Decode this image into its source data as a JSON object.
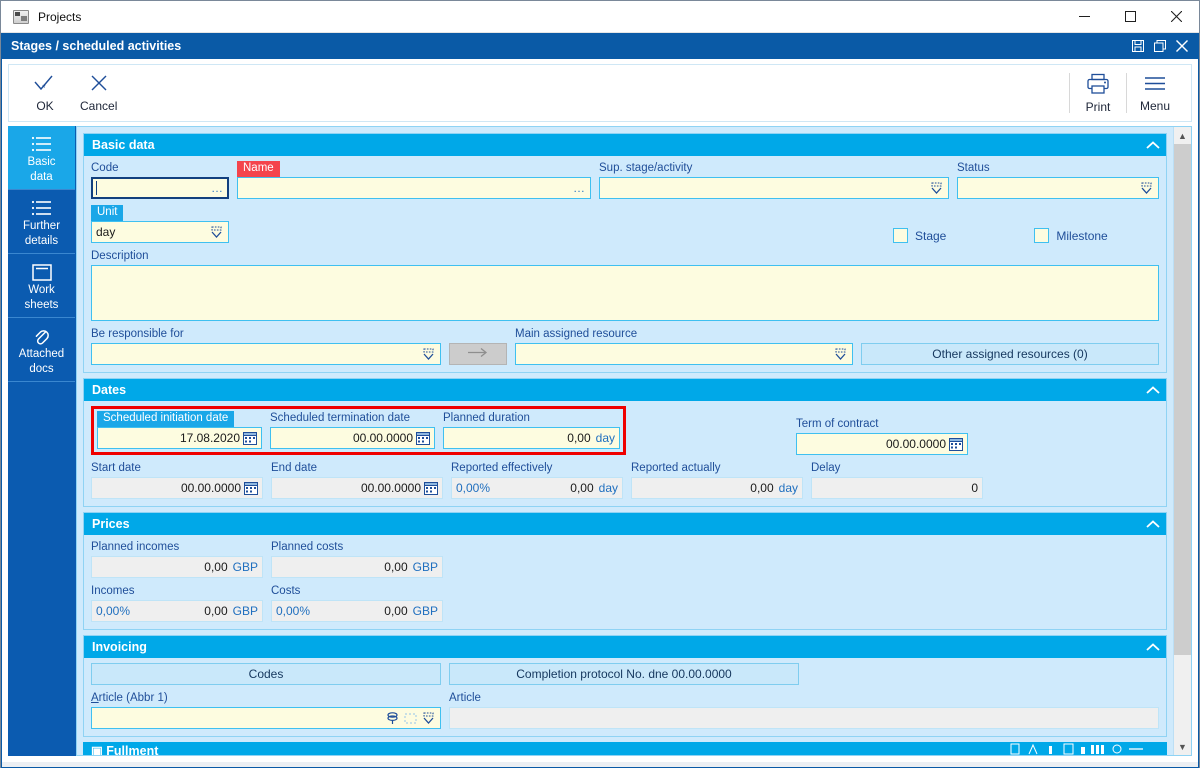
{
  "os": {
    "title": "Projects",
    "app_icon": "application-icon",
    "minimize": "—",
    "maximize": "☐",
    "close": "✕"
  },
  "inner_window": {
    "title": "Stages / scheduled activities",
    "save_icon": "save-icon",
    "restore_icon": "restore-icon",
    "close_icon": "close-icon"
  },
  "commandbar": {
    "ok": "OK",
    "cancel": "Cancel",
    "print": "Print",
    "menu": "Menu"
  },
  "sidebar": {
    "items": [
      {
        "label_line1": "Basic",
        "label_line2": "data",
        "icon": "list-icon",
        "active": true
      },
      {
        "label_line1": "Further",
        "label_line2": "details",
        "icon": "list-icon",
        "active": false
      },
      {
        "label_line1": "Work",
        "label_line2": "sheets",
        "icon": "worksheet-icon",
        "active": false
      },
      {
        "label_line1": "Attached",
        "label_line2": "docs",
        "icon": "paperclip-icon",
        "active": false
      }
    ]
  },
  "sections": {
    "basic_data": {
      "title": "Basic data",
      "code": {
        "label": "Code",
        "value": "",
        "ellipsis": "…"
      },
      "name": {
        "label": "Name",
        "value": "",
        "ellipsis": "…"
      },
      "sup_stage": {
        "label": "Sup. stage/activity",
        "value": ""
      },
      "status": {
        "label": "Status",
        "value": ""
      },
      "unit": {
        "label": "Unit",
        "value": "day"
      },
      "stage_checkbox": {
        "label": "Stage",
        "checked": false
      },
      "milestone_checkbox": {
        "label": "Milestone",
        "checked": false
      },
      "description": {
        "label": "Description",
        "value": ""
      },
      "be_responsible_for": {
        "label": "Be responsible for",
        "value": ""
      },
      "transfer_button": "→",
      "main_assigned_resource": {
        "label": "Main assigned resource",
        "value": ""
      },
      "other_assigned_resources": "Other assigned resources (0)"
    },
    "dates": {
      "title": "Dates",
      "scheduled_initiation_date": {
        "label": "Scheduled initiation date",
        "value": "17.08.2020"
      },
      "scheduled_termination_date": {
        "label": "Scheduled termination date",
        "value": "00.00.0000"
      },
      "planned_duration": {
        "label": "Planned duration",
        "value": "0,00",
        "unit": "day"
      },
      "term_of_contract": {
        "label": "Term of contract",
        "value": "00.00.0000"
      },
      "start_date": {
        "label": "Start date",
        "value": "00.00.0000"
      },
      "end_date": {
        "label": "End date",
        "value": "00.00.0000"
      },
      "reported_effectively": {
        "label": "Reported effectively",
        "percent": "0,00%",
        "value": "0,00",
        "unit": "day"
      },
      "reported_actually": {
        "label": "Reported actually",
        "value": "0,00",
        "unit": "day"
      },
      "delay": {
        "label": "Delay",
        "value": "0"
      }
    },
    "prices": {
      "title": "Prices",
      "planned_incomes": {
        "label": "Planned incomes",
        "value": "0,00",
        "currency": "GBP"
      },
      "planned_costs": {
        "label": "Planned costs",
        "value": "0,00",
        "currency": "GBP"
      },
      "incomes": {
        "label": "Incomes",
        "percent": "0,00%",
        "value": "0,00",
        "currency": "GBP"
      },
      "costs": {
        "label": "Costs",
        "percent": "0,00%",
        "value": "0,00",
        "currency": "GBP"
      }
    },
    "invoicing": {
      "title": "Invoicing",
      "codes_button": "Codes",
      "completion_protocol_button": "Completion protocol No.  dne 00.00.0000",
      "article_abbr": {
        "label_accel": "A",
        "label_rest": "rticle (Abbr 1)",
        "value": ""
      },
      "article": {
        "label": "Article",
        "value": ""
      }
    }
  },
  "colors": {
    "section_header": "#00a8e8",
    "inner_titlebar": "#0a5aa6",
    "sidebar": "#0b5bb0",
    "sidebar_active": "#1aa7e8",
    "canvas": "#cfeafc",
    "field_bg": "#fdfce0",
    "field_border": "#3fc0f0",
    "readonly_bg": "#efefef",
    "required_badge": "#f4444c",
    "highlight_box": "#ef0000",
    "label_text": "#1f4e99"
  }
}
